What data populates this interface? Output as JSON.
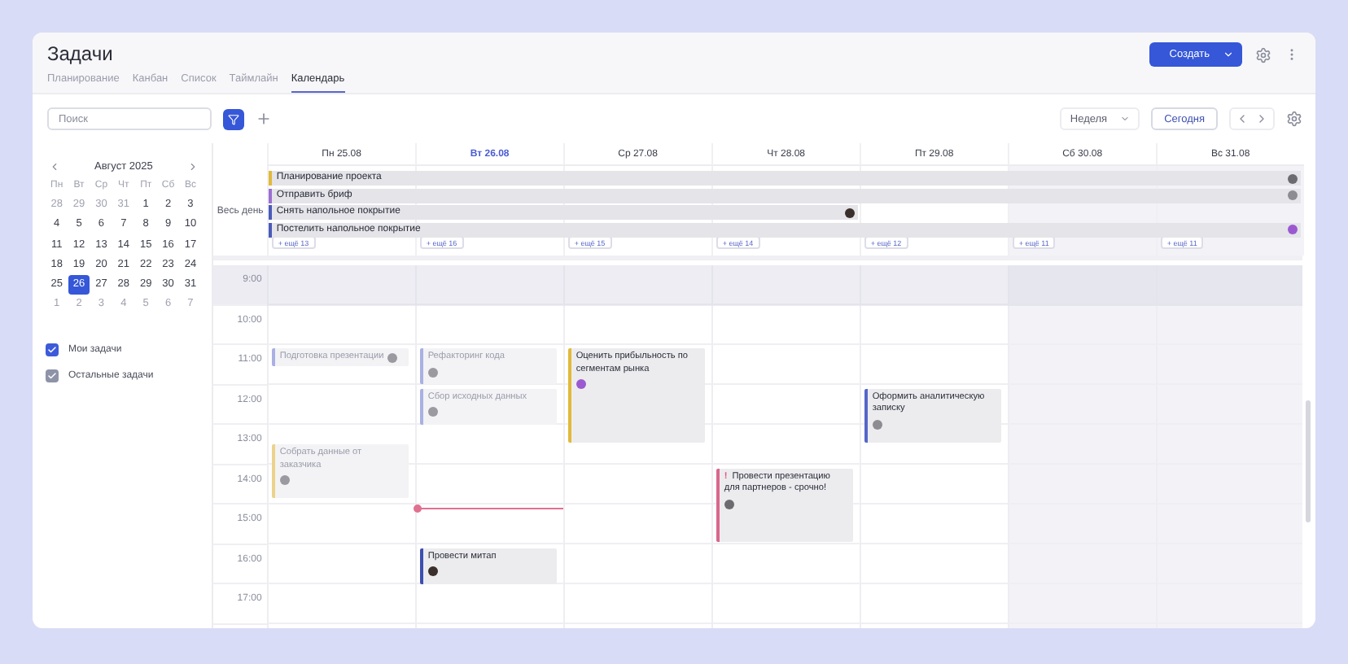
{
  "header": {
    "title": "Задачи",
    "tabs": [
      {
        "label": "Планирование",
        "selected": false
      },
      {
        "label": "Канбан",
        "selected": false
      },
      {
        "label": "Список",
        "selected": false
      },
      {
        "label": "Таймлайн",
        "selected": false
      },
      {
        "label": "Календарь",
        "selected": true
      }
    ],
    "create_button": "Создать"
  },
  "toolbar": {
    "search": {
      "placeholder": "Поиск"
    },
    "view_select": "Неделя",
    "today_button": "Сегодня"
  },
  "mini_calendar": {
    "month": "Август 2025",
    "weekdays": [
      "Пн",
      "Вт",
      "Ср",
      "Чт",
      "Пт",
      "Сб",
      "Вс"
    ],
    "weeks": [
      {
        "days": [
          {
            "d": "28",
            "muted": true,
            "selected": false
          },
          {
            "d": "29",
            "muted": true,
            "selected": false
          },
          {
            "d": "30",
            "muted": true,
            "selected": false
          },
          {
            "d": "31",
            "muted": true,
            "selected": false
          },
          {
            "d": "1",
            "muted": false,
            "selected": false
          },
          {
            "d": "2",
            "muted": false,
            "selected": false
          },
          {
            "d": "3",
            "muted": false,
            "selected": false
          }
        ]
      },
      {
        "days": [
          {
            "d": "4",
            "muted": false,
            "selected": false
          },
          {
            "d": "5",
            "muted": false,
            "selected": false
          },
          {
            "d": "6",
            "muted": false,
            "selected": false
          },
          {
            "d": "7",
            "muted": false,
            "selected": false
          },
          {
            "d": "8",
            "muted": false,
            "selected": false
          },
          {
            "d": "9",
            "muted": false,
            "selected": false
          },
          {
            "d": "10",
            "muted": false,
            "selected": false
          }
        ]
      },
      {
        "days": [
          {
            "d": "11",
            "muted": false,
            "selected": false
          },
          {
            "d": "12",
            "muted": false,
            "selected": false
          },
          {
            "d": "13",
            "muted": false,
            "selected": false
          },
          {
            "d": "14",
            "muted": false,
            "selected": false
          },
          {
            "d": "15",
            "muted": false,
            "selected": false
          },
          {
            "d": "16",
            "muted": false,
            "selected": false
          },
          {
            "d": "17",
            "muted": false,
            "selected": false
          }
        ]
      },
      {
        "days": [
          {
            "d": "18",
            "muted": false,
            "selected": false
          },
          {
            "d": "19",
            "muted": false,
            "selected": false
          },
          {
            "d": "20",
            "muted": false,
            "selected": false
          },
          {
            "d": "21",
            "muted": false,
            "selected": false
          },
          {
            "d": "22",
            "muted": false,
            "selected": false
          },
          {
            "d": "23",
            "muted": false,
            "selected": false
          },
          {
            "d": "24",
            "muted": false,
            "selected": false
          }
        ]
      },
      {
        "days": [
          {
            "d": "25",
            "muted": false,
            "selected": false
          },
          {
            "d": "26",
            "muted": false,
            "selected": true
          },
          {
            "d": "27",
            "muted": false,
            "selected": false
          },
          {
            "d": "28",
            "muted": false,
            "selected": false
          },
          {
            "d": "29",
            "muted": false,
            "selected": false
          },
          {
            "d": "30",
            "muted": false,
            "selected": false
          },
          {
            "d": "31",
            "muted": false,
            "selected": false
          }
        ]
      },
      {
        "days": [
          {
            "d": "1",
            "muted": true,
            "selected": false
          },
          {
            "d": "2",
            "muted": true,
            "selected": false
          },
          {
            "d": "3",
            "muted": true,
            "selected": false
          },
          {
            "d": "4",
            "muted": true,
            "selected": false
          },
          {
            "d": "5",
            "muted": true,
            "selected": false
          },
          {
            "d": "6",
            "muted": true,
            "selected": false
          },
          {
            "d": "7",
            "muted": true,
            "selected": false
          }
        ]
      }
    ]
  },
  "filters": [
    {
      "label": "Мои задачи",
      "checked": true,
      "color": "#3d5bd9"
    },
    {
      "label": "Остальные задачи",
      "checked": true,
      "color": "#8e93a8"
    }
  ],
  "calendar": {
    "all_day_label": "Весь день",
    "days": [
      {
        "label": "Пн 25.08",
        "today": false,
        "weekend": false,
        "now": false,
        "more": "+ ещё 13"
      },
      {
        "label": "Вт 26.08",
        "today": true,
        "weekend": false,
        "now": true,
        "more": "+ ещё 16"
      },
      {
        "label": "Ср 27.08",
        "today": false,
        "weekend": false,
        "now": false,
        "more": "+ ещё 15"
      },
      {
        "label": "Чт 28.08",
        "today": false,
        "weekend": false,
        "now": false,
        "more": "+ ещё 14"
      },
      {
        "label": "Пт 29.08",
        "today": false,
        "weekend": false,
        "now": false,
        "more": "+ ещё 12"
      },
      {
        "label": "Сб 30.08",
        "today": false,
        "weekend": true,
        "now": false,
        "more": "+ ещё 11"
      },
      {
        "label": "Вс 31.08",
        "today": false,
        "weekend": true,
        "now": false,
        "more": "+ ещё 11"
      }
    ],
    "all_day_events": [
      {
        "title": "Планирование проекта",
        "color": "#e2b93b",
        "whole_week": true
      },
      {
        "title": "Отправить бриф",
        "color": "#9b6fd0",
        "whole_week": true
      },
      {
        "title": "Снять напольное покрытие",
        "color": "#4a5bb8",
        "whole_week": false
      },
      {
        "title": "Постелить напольное покрытие",
        "color": "#4a5bb8",
        "whole_week": true
      }
    ],
    "hours": [
      {
        "label": "9:00",
        "off": true
      },
      {
        "label": "10:00",
        "off": false
      },
      {
        "label": "11:00",
        "off": false,
        "cells": [
          {
            "events": [
              {
                "title": "Подготовка презентации",
                "kind": "inline",
                "color": "#a9b0e4",
                "done": true
              }
            ]
          },
          {
            "events": [
              {
                "title": "Рефакторинг кода",
                "kind": "hour",
                "color": "#a9b0e4",
                "done": true
              }
            ]
          },
          {
            "events": [
              {
                "title": "Оценить прибыльность по сегментам рынка",
                "kind": "extended",
                "color": "#e2b93b",
                "done": false
              }
            ]
          }
        ]
      },
      {
        "label": "12:00",
        "off": false,
        "cells": [
          {},
          {
            "events": [
              {
                "title": "Сбор исходных данных",
                "kind": "hour",
                "color": "#a9b0e4",
                "done": true
              }
            ]
          },
          {},
          {},
          {
            "events": [
              {
                "title": "Оформить аналитическую записку",
                "kind": "long",
                "color": "#5566c8",
                "done": false
              }
            ]
          }
        ]
      },
      {
        "label": "13:00",
        "off": false,
        "cells": [
          {
            "events": [
              {
                "title": "Собрать данные от заказчика",
                "kind": "late",
                "color": "#ecd38a",
                "done": true
              }
            ]
          }
        ]
      },
      {
        "label": "14:00",
        "off": false,
        "cells": [
          {},
          {},
          {},
          {
            "events": [
              {
                "title": "Провести презентацию для партнеров - срочно!",
                "mark": "!",
                "kind": "double",
                "color": "#d9678c",
                "done": false
              }
            ]
          }
        ]
      },
      {
        "label": "15:00",
        "off": false
      },
      {
        "label": "16:00",
        "off": false,
        "cells": [
          {},
          {
            "events": [
              {
                "title": "Провести митап",
                "kind": "hour",
                "color": "#3d4fb0",
                "done": false
              }
            ]
          }
        ]
      },
      {
        "label": "17:00",
        "off": false
      }
    ]
  }
}
